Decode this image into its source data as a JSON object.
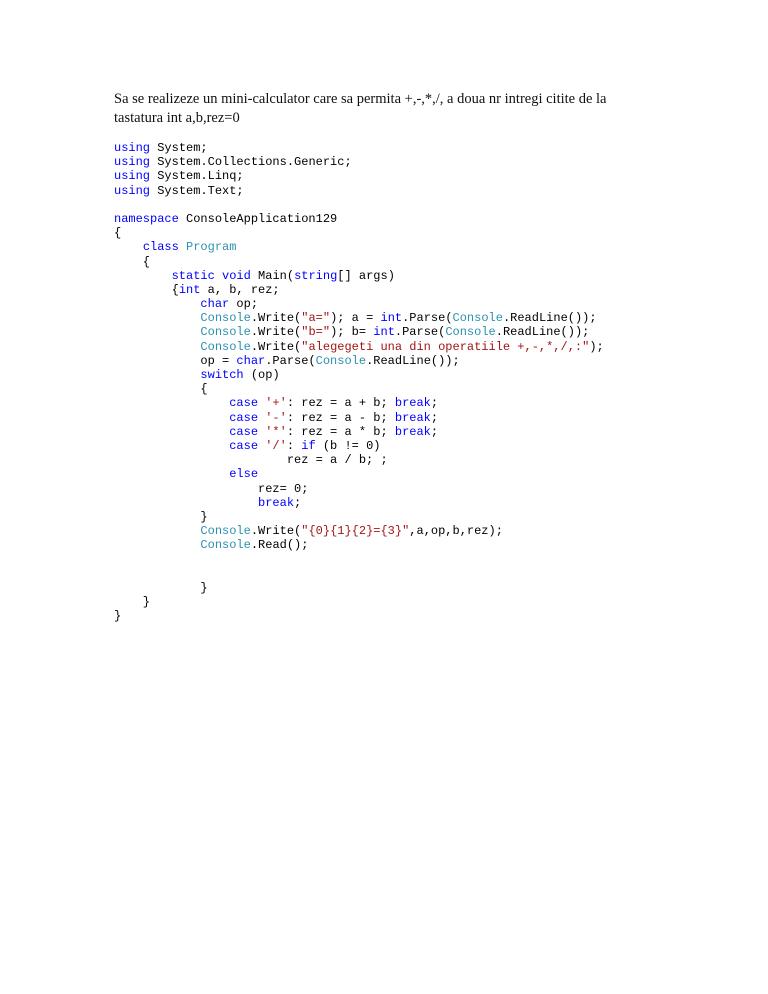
{
  "document": {
    "intro_line1": "Sa se realizeze un mini-calculator care sa permita +,-,*,/, a doua nr intregi citite de la",
    "intro_line2": "tastatura int a,b,rez=0"
  },
  "colors": {
    "keyword": "#0000ff",
    "type": "#2b91af",
    "string": "#a31515",
    "plain": "#000000"
  },
  "code_lines": [
    [
      {
        "t": "k",
        "v": "using"
      },
      {
        "t": "p",
        "v": " System;"
      }
    ],
    [
      {
        "t": "k",
        "v": "using"
      },
      {
        "t": "p",
        "v": " System.Collections.Generic;"
      }
    ],
    [
      {
        "t": "k",
        "v": "using"
      },
      {
        "t": "p",
        "v": " System.Linq;"
      }
    ],
    [
      {
        "t": "k",
        "v": "using"
      },
      {
        "t": "p",
        "v": " System.Text;"
      }
    ],
    [],
    [
      {
        "t": "k",
        "v": "namespace"
      },
      {
        "t": "p",
        "v": " ConsoleApplication129"
      }
    ],
    [
      {
        "t": "p",
        "v": "{"
      }
    ],
    [
      {
        "t": "p",
        "v": "    "
      },
      {
        "t": "k",
        "v": "class"
      },
      {
        "t": "p",
        "v": " "
      },
      {
        "t": "y",
        "v": "Program"
      }
    ],
    [
      {
        "t": "p",
        "v": "    {"
      }
    ],
    [
      {
        "t": "p",
        "v": "        "
      },
      {
        "t": "k",
        "v": "static"
      },
      {
        "t": "p",
        "v": " "
      },
      {
        "t": "k",
        "v": "void"
      },
      {
        "t": "p",
        "v": " Main("
      },
      {
        "t": "k",
        "v": "string"
      },
      {
        "t": "p",
        "v": "[] args)"
      }
    ],
    [
      {
        "t": "p",
        "v": "        {"
      },
      {
        "t": "k",
        "v": "int"
      },
      {
        "t": "p",
        "v": " a, b, rez;"
      }
    ],
    [
      {
        "t": "p",
        "v": "            "
      },
      {
        "t": "k",
        "v": "char"
      },
      {
        "t": "p",
        "v": " op;"
      }
    ],
    [
      {
        "t": "p",
        "v": "            "
      },
      {
        "t": "y",
        "v": "Console"
      },
      {
        "t": "p",
        "v": ".Write("
      },
      {
        "t": "s",
        "v": "\"a=\""
      },
      {
        "t": "p",
        "v": "); a = "
      },
      {
        "t": "k",
        "v": "int"
      },
      {
        "t": "p",
        "v": ".Parse("
      },
      {
        "t": "y",
        "v": "Console"
      },
      {
        "t": "p",
        "v": ".ReadLine());"
      }
    ],
    [
      {
        "t": "p",
        "v": "            "
      },
      {
        "t": "y",
        "v": "Console"
      },
      {
        "t": "p",
        "v": ".Write("
      },
      {
        "t": "s",
        "v": "\"b=\""
      },
      {
        "t": "p",
        "v": "); b= "
      },
      {
        "t": "k",
        "v": "int"
      },
      {
        "t": "p",
        "v": ".Parse("
      },
      {
        "t": "y",
        "v": "Console"
      },
      {
        "t": "p",
        "v": ".ReadLine());"
      }
    ],
    [
      {
        "t": "p",
        "v": "            "
      },
      {
        "t": "y",
        "v": "Console"
      },
      {
        "t": "p",
        "v": ".Write("
      },
      {
        "t": "s",
        "v": "\"alegegeti una din operatiile +,-,*,/,:\""
      },
      {
        "t": "p",
        "v": ");"
      }
    ],
    [
      {
        "t": "p",
        "v": "            op = "
      },
      {
        "t": "k",
        "v": "char"
      },
      {
        "t": "p",
        "v": ".Parse("
      },
      {
        "t": "y",
        "v": "Console"
      },
      {
        "t": "p",
        "v": ".ReadLine());"
      }
    ],
    [
      {
        "t": "p",
        "v": "            "
      },
      {
        "t": "k",
        "v": "switch"
      },
      {
        "t": "p",
        "v": " (op)"
      }
    ],
    [
      {
        "t": "p",
        "v": "            {"
      }
    ],
    [
      {
        "t": "p",
        "v": "                "
      },
      {
        "t": "k",
        "v": "case"
      },
      {
        "t": "p",
        "v": " "
      },
      {
        "t": "s",
        "v": "'+'"
      },
      {
        "t": "p",
        "v": ": rez = a + b; "
      },
      {
        "t": "k",
        "v": "break"
      },
      {
        "t": "p",
        "v": ";"
      }
    ],
    [
      {
        "t": "p",
        "v": "                "
      },
      {
        "t": "k",
        "v": "case"
      },
      {
        "t": "p",
        "v": " "
      },
      {
        "t": "s",
        "v": "'-'"
      },
      {
        "t": "p",
        "v": ": rez = a - b; "
      },
      {
        "t": "k",
        "v": "break"
      },
      {
        "t": "p",
        "v": ";"
      }
    ],
    [
      {
        "t": "p",
        "v": "                "
      },
      {
        "t": "k",
        "v": "case"
      },
      {
        "t": "p",
        "v": " "
      },
      {
        "t": "s",
        "v": "'*'"
      },
      {
        "t": "p",
        "v": ": rez = a * b; "
      },
      {
        "t": "k",
        "v": "break"
      },
      {
        "t": "p",
        "v": ";"
      }
    ],
    [
      {
        "t": "p",
        "v": "                "
      },
      {
        "t": "k",
        "v": "case"
      },
      {
        "t": "p",
        "v": " "
      },
      {
        "t": "s",
        "v": "'/'"
      },
      {
        "t": "p",
        "v": ": "
      },
      {
        "t": "k",
        "v": "if"
      },
      {
        "t": "p",
        "v": " (b != 0)"
      }
    ],
    [
      {
        "t": "p",
        "v": "                        rez = a / b; ;"
      }
    ],
    [
      {
        "t": "p",
        "v": "                "
      },
      {
        "t": "k",
        "v": "else"
      }
    ],
    [
      {
        "t": "p",
        "v": "                    rez= 0;"
      }
    ],
    [
      {
        "t": "p",
        "v": "                    "
      },
      {
        "t": "k",
        "v": "break"
      },
      {
        "t": "p",
        "v": ";"
      }
    ],
    [
      {
        "t": "p",
        "v": "            }"
      }
    ],
    [
      {
        "t": "p",
        "v": "            "
      },
      {
        "t": "y",
        "v": "Console"
      },
      {
        "t": "p",
        "v": ".Write("
      },
      {
        "t": "s",
        "v": "\"{0}{1}{2}={3}\""
      },
      {
        "t": "p",
        "v": ",a,op,b,rez);"
      }
    ],
    [
      {
        "t": "p",
        "v": "            "
      },
      {
        "t": "y",
        "v": "Console"
      },
      {
        "t": "p",
        "v": ".Read();"
      }
    ],
    [],
    [],
    [
      {
        "t": "p",
        "v": "            }"
      }
    ],
    [
      {
        "t": "p",
        "v": "    }"
      }
    ],
    [
      {
        "t": "p",
        "v": "}"
      }
    ]
  ]
}
